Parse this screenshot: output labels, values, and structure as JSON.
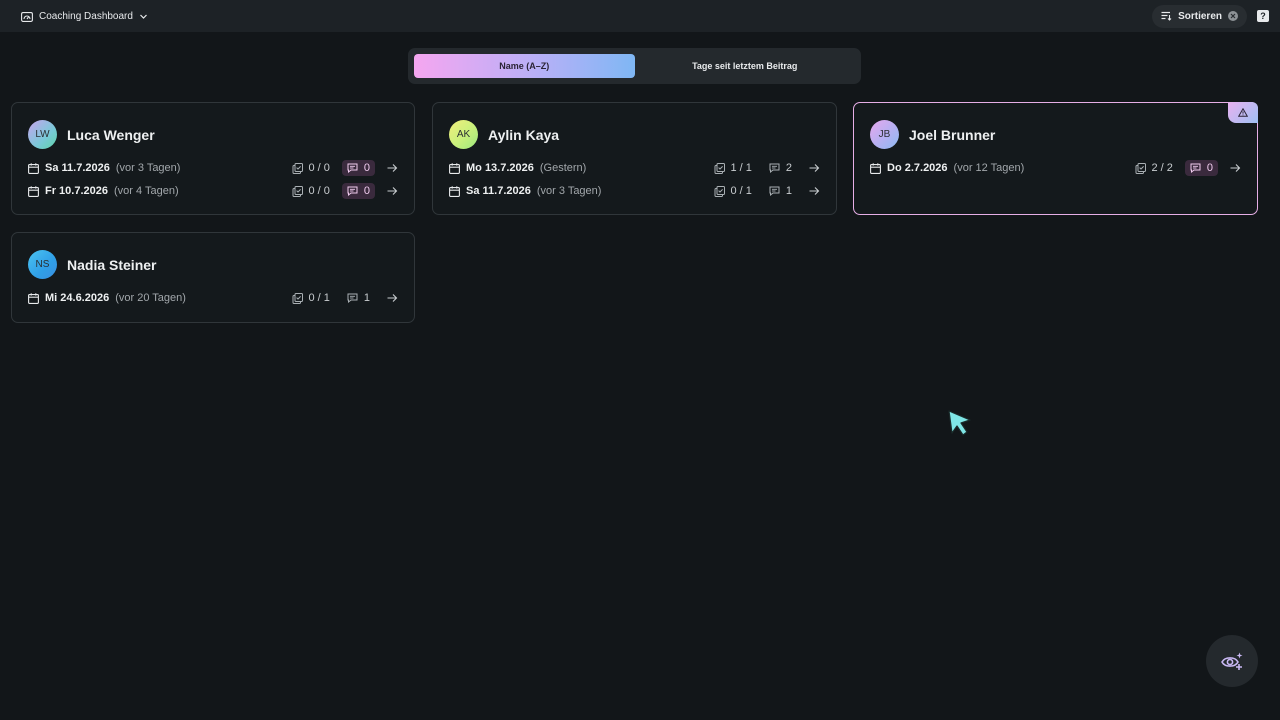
{
  "topbar": {
    "app_title": "Coaching Dashboard",
    "sort_label": "Sortieren",
    "help_label": "?"
  },
  "sort_toggle": {
    "options": [
      {
        "label": "Name (A–Z)",
        "active": true
      },
      {
        "label": "Tage seit letztem Beitrag",
        "active": false
      }
    ]
  },
  "colors": {
    "accent_pink": "#f5a6f0",
    "accent_blue": "#7fb7f4",
    "flag_border": "#e6aee6"
  },
  "cards": [
    {
      "initials": "LW",
      "name": "Luca Wenger",
      "flagged": false,
      "entries": [
        {
          "date": "Sa 11.7.2026",
          "relative": "(vor 3 Tagen)",
          "tasks": "0 / 0",
          "comments": "0",
          "comments_highlight": true
        },
        {
          "date": "Fr 10.7.2026",
          "relative": "(vor 4 Tagen)",
          "tasks": "0 / 0",
          "comments": "0",
          "comments_highlight": true
        }
      ]
    },
    {
      "initials": "AK",
      "name": "Aylin Kaya",
      "flagged": false,
      "entries": [
        {
          "date": "Mo 13.7.2026",
          "relative": "(Gestern)",
          "tasks": "1 / 1",
          "comments": "2",
          "comments_highlight": false
        },
        {
          "date": "Sa 11.7.2026",
          "relative": "(vor 3 Tagen)",
          "tasks": "0 / 1",
          "comments": "1",
          "comments_highlight": false
        }
      ]
    },
    {
      "initials": "JB",
      "name": "Joel Brunner",
      "flagged": true,
      "flag_icon": "warning-triangle-icon",
      "entries": [
        {
          "date": "Do 2.7.2026",
          "relative": "(vor 12 Tagen)",
          "tasks": "2 / 2",
          "comments": "0",
          "comments_highlight": true
        }
      ]
    },
    {
      "initials": "NS",
      "name": "Nadia Steiner",
      "flagged": false,
      "entries": [
        {
          "date": "Mi 24.6.2026",
          "relative": "(vor 20 Tagen)",
          "tasks": "0 / 1",
          "comments": "1",
          "comments_highlight": false
        }
      ]
    }
  ],
  "fab": {
    "icon": "eye-sparkle-icon"
  }
}
